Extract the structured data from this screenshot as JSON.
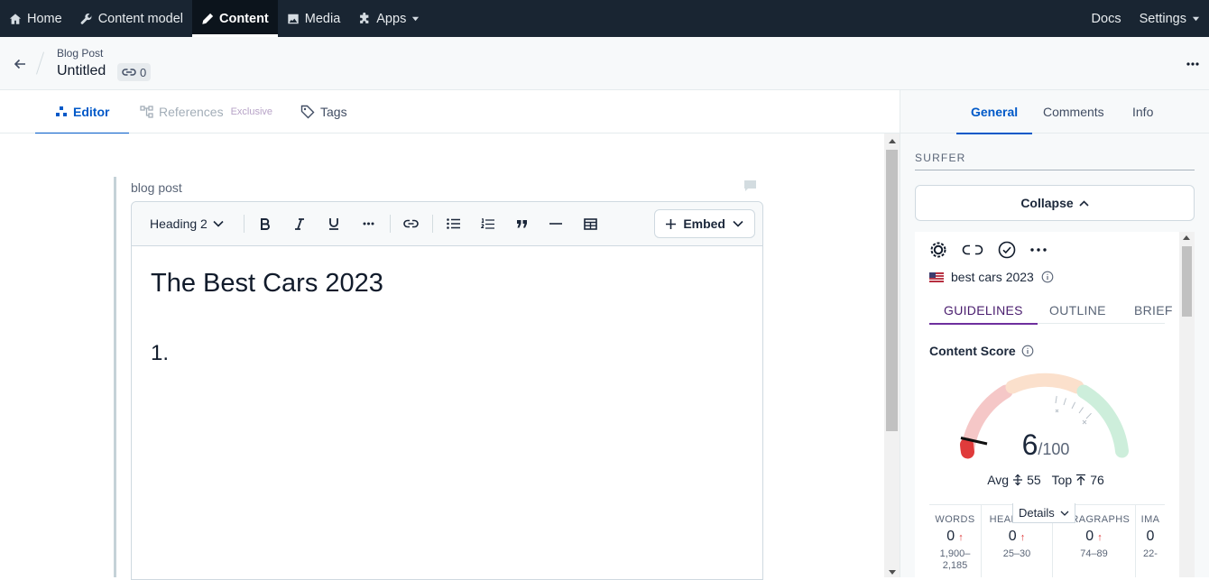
{
  "nav": {
    "items": [
      {
        "label": "Home",
        "icon": "home-icon"
      },
      {
        "label": "Content model",
        "icon": "wrench-icon"
      },
      {
        "label": "Content",
        "icon": "pen-icon"
      },
      {
        "label": "Media",
        "icon": "image-icon"
      },
      {
        "label": "Apps",
        "icon": "puzzle-icon"
      }
    ],
    "right": [
      "Docs",
      "Settings"
    ]
  },
  "entry": {
    "content_type": "Blog Post",
    "title": "Untitled",
    "references_count": "0"
  },
  "tabs": {
    "editor": "Editor",
    "references": "References",
    "references_suffix": "Exclusive",
    "tags": "Tags"
  },
  "editor": {
    "field_label": "blog post",
    "toolbar": {
      "heading_select": "Heading 2",
      "embed_label": "Embed"
    },
    "document": {
      "heading": "The Best Cars 2023",
      "list_item_number": "1."
    }
  },
  "sidebar": {
    "tabs": [
      "General",
      "Comments",
      "Info"
    ],
    "active_tab": "General",
    "section_title": "SURFER",
    "collapse_label": "Collapse",
    "surfer": {
      "keyword": "best cars 2023",
      "tabs": [
        "GUIDELINES",
        "OUTLINE",
        "BRIEF"
      ],
      "content_score_label": "Content Score",
      "score": "6",
      "score_max": "/100",
      "avg_label": "Avg",
      "avg_value": "55",
      "top_label": "Top",
      "top_value": "76",
      "details_label": "Details",
      "stats": [
        {
          "label": "WORDS",
          "value": "0",
          "range": "1,900–2,185"
        },
        {
          "label": "HEADINGS",
          "value": "0",
          "range": "25–30"
        },
        {
          "label": "PARAGRAPHS",
          "value": "0",
          "range": "74–89"
        },
        {
          "label": "IMA",
          "value": "0",
          "range": "22-"
        }
      ]
    }
  },
  "colors": {
    "nav_bg": "#192532",
    "accent": "#0059c8",
    "surfer_purple": "#6e2f9e",
    "gauge_red": "#f5c7c7",
    "gauge_orange": "#fbe0cc",
    "gauge_green": "#cdeedb",
    "score_marker": "#e03b3b"
  }
}
